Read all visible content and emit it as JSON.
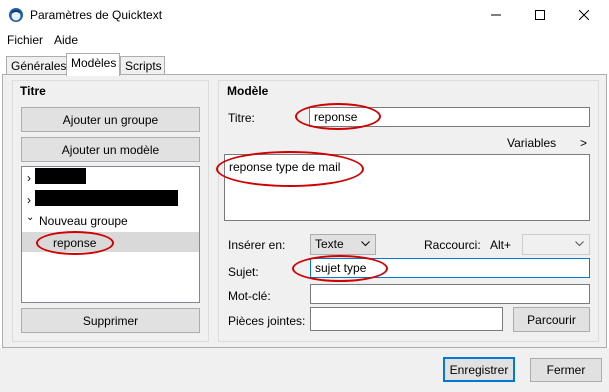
{
  "window": {
    "title": "Paramètres de Quicktext",
    "minimize_icon": "minimize-icon",
    "maximize_icon": "maximize-icon",
    "close_icon": "close-icon"
  },
  "menu": [
    "Fichier",
    "Aide"
  ],
  "tabs": [
    "Générales",
    "Modèles",
    "Scripts"
  ],
  "active_tab": "Modèles",
  "left_panel": {
    "title": "Titre",
    "add_group_label": "Ajouter un groupe",
    "add_template_label": "Ajouter un modèle",
    "tree": {
      "group_name": "Nouveau groupe",
      "selected_item": "reponse"
    },
    "delete_label": "Supprimer"
  },
  "right_panel": {
    "title": "Modèle",
    "title_label": "Titre:",
    "title_value": "reponse",
    "variables_label": "Variables",
    "variables_chevron": ">",
    "body_value": "reponse type de mail",
    "insert_label": "Insérer en:",
    "insert_value": "Texte",
    "shortcut_label": "Raccourci:",
    "shortcut_modifier": "Alt+",
    "shortcut_value": "",
    "subject_label": "Sujet:",
    "subject_value": "sujet type",
    "keyword_label": "Mot-clé:",
    "keyword_value": "",
    "attachments_label": "Pièces jointes:",
    "attachments_value": "",
    "browse_label": "Parcourir"
  },
  "footer": {
    "save_label": "Enregistrer",
    "close_label": "Fermer"
  },
  "colors": {
    "accent": "#0078d7",
    "annotation": "#d00000",
    "redaction": "#000000"
  }
}
